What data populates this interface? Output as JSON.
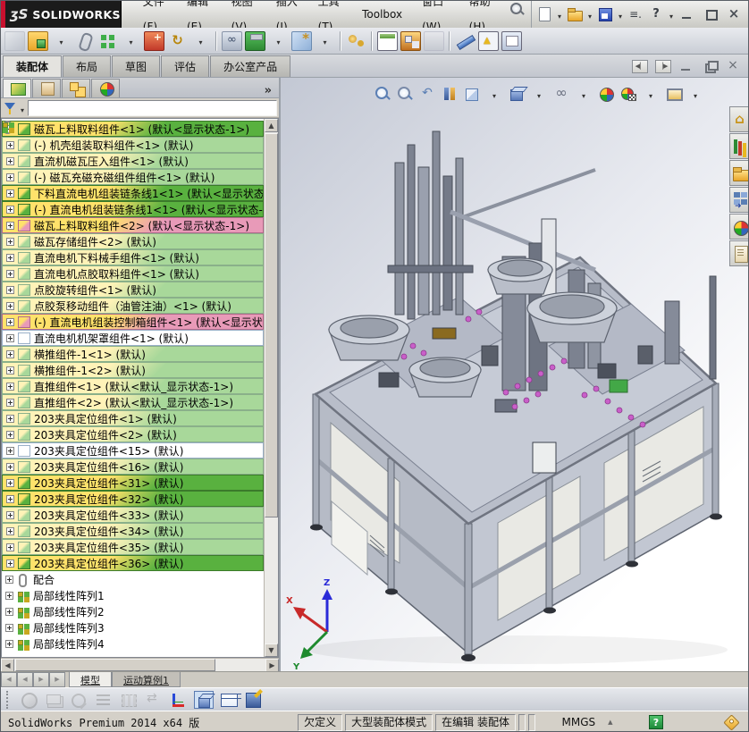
{
  "titlebar": {
    "logo_prefix": "ʒS",
    "logo_text": "SOLIDWORKS",
    "menus": [
      "文件(F)",
      "编辑(E)",
      "视图(V)",
      "插入(I)",
      "工具(T)",
      "Toolbox",
      "窗口(W)",
      "帮助(H)"
    ],
    "quick_access": [
      {
        "cls": "qa-new",
        "name": "new-document-icon"
      },
      {
        "cls": "drop",
        "name": "dropdown-arrow"
      },
      {
        "cls": "qa-open",
        "name": "open-document-icon"
      },
      {
        "cls": "drop",
        "name": "dropdown-arrow"
      },
      {
        "cls": "qa-save",
        "name": "save-document-icon"
      },
      {
        "cls": "drop",
        "name": "dropdown-arrow"
      },
      {
        "cls": "qa-props",
        "name": "properties-icon",
        "label": "≡."
      },
      {
        "cls": "qa-help",
        "name": "help-icon",
        "label": "?"
      },
      {
        "cls": "drop",
        "name": "dropdown-arrow"
      }
    ]
  },
  "main_toolbar": [
    {
      "cls": "ti-insert",
      "name": "insert-component-icon"
    },
    {
      "cls": "ti-open",
      "name": "open-part-icon"
    },
    {
      "cls": "drop",
      "name": "dropdown-arrow"
    },
    {
      "cls": "ti-mate",
      "name": "mate-icon"
    },
    {
      "cls": "ti-pattern",
      "name": "linear-component-pattern-icon"
    },
    {
      "cls": "drop",
      "name": "dropdown-arrow"
    },
    {
      "cls": "ti-fasteners",
      "name": "smart-fasteners-icon"
    },
    {
      "cls": "ti-move",
      "name": "move-component-icon"
    },
    {
      "cls": "drop",
      "name": "dropdown-arrow"
    },
    {
      "cls": "tsep",
      "name": "separator"
    },
    {
      "cls": "ti-hidden",
      "name": "show-hidden-components-icon"
    },
    {
      "cls": "ti-asmfeat",
      "name": "assembly-features-icon"
    },
    {
      "cls": "drop",
      "name": "dropdown-arrow"
    },
    {
      "cls": "ti-refgeo",
      "name": "reference-geometry-icon"
    },
    {
      "cls": "drop",
      "name": "dropdown-arrow"
    },
    {
      "cls": "tsep",
      "name": "separator"
    },
    {
      "cls": "ti-motion",
      "name": "new-motion-study-icon"
    },
    {
      "cls": "tsep",
      "name": "separator"
    },
    {
      "cls": "ti-bom",
      "name": "bill-of-materials-icon"
    },
    {
      "cls": "ti-explode",
      "name": "exploded-view-icon"
    },
    {
      "cls": "ti-explodeline",
      "name": "explode-line-sketch-icon"
    },
    {
      "cls": "tsep",
      "name": "separator"
    },
    {
      "cls": "ti-route",
      "name": "route-line-icon"
    },
    {
      "cls": "ti-interfere",
      "name": "interference-detection-icon"
    },
    {
      "cls": "ti-pic",
      "name": "snapshot-icon"
    }
  ],
  "command_tabs": [
    {
      "label": "装配体",
      "cls": "active"
    },
    {
      "label": "布局",
      "cls": ""
    },
    {
      "label": "草图",
      "cls": ""
    },
    {
      "label": "评估",
      "cls": ""
    },
    {
      "label": "办公室产品",
      "cls": ""
    }
  ],
  "feature_panel": {
    "fm_tabs": [
      {
        "cls": "fm-tree active",
        "name": "featuremanager-tree-tab"
      },
      {
        "cls": "fm-prop",
        "name": "propertymanager-tab"
      },
      {
        "cls": "fm-config",
        "name": "configurationmanager-tab"
      },
      {
        "cls": "fm-display",
        "name": "displaymanager-tab"
      }
    ],
    "overflow": "»",
    "tree": [
      {
        "cls": "ic-asm",
        "label": "磁瓦上料取料组件<1> (默认<显示状态-1>)"
      },
      {
        "cls": "ic-asm-light",
        "label": "(-) 机壳组装取料组件<1> (默认)"
      },
      {
        "cls": "ic-asm-light",
        "label": "直流机磁瓦压入组件<1> (默认)"
      },
      {
        "cls": "ic-asm-light",
        "label": "(-) 磁瓦充磁充磁组件组件<1> (默认)"
      },
      {
        "cls": "ic-asm",
        "label": "下料直流电机组装链条线1<1> (默认<显示状态-"
      },
      {
        "cls": "ic-asm",
        "label": "(-) 直流电机组装链条线1<1> (默认<显示状态-"
      },
      {
        "cls": "ic-asm-flex",
        "label": "磁瓦上料取料组件<2> (默认<显示状态-1>)"
      },
      {
        "cls": "ic-asm-light",
        "label": "磁瓦存储组件<2> (默认)"
      },
      {
        "cls": "ic-asm-light",
        "label": "直流电机下料械手组件<1> (默认)"
      },
      {
        "cls": "ic-asm-light",
        "label": "直流电机点胶取料组件<1> (默认)"
      },
      {
        "cls": "ic-asm-light",
        "label": "点胶旋转组件<1> (默认)"
      },
      {
        "cls": "ic-asm-light",
        "label": "点胶泵移动组件（油管注油）<1> (默认)"
      },
      {
        "cls": "ic-asm-flex",
        "label": "(-) 直流电机组装控制箱组件<1> (默认<显示状"
      },
      {
        "cls": "ic-asm-hidden",
        "label": "直流电机机架罩组件<1> (默认)"
      },
      {
        "cls": "ic-asm-light",
        "label": "横推组件-1<1> (默认)"
      },
      {
        "cls": "ic-asm-light",
        "label": "横推组件-1<2> (默认)"
      },
      {
        "cls": "ic-asm-light",
        "label": "直推组件<1> (默认<默认_显示状态-1>)"
      },
      {
        "cls": "ic-asm-light",
        "label": "直推组件<2> (默认<默认_显示状态-1>)"
      },
      {
        "cls": "ic-asm-light",
        "label": "203夹具定位组件<1> (默认)"
      },
      {
        "cls": "ic-asm-light",
        "label": "203夹具定位组件<2> (默认)"
      },
      {
        "cls": "ic-asm-hidden",
        "label": "203夹具定位组件<15> (默认)"
      },
      {
        "cls": "ic-asm-light",
        "label": "203夹具定位组件<16> (默认)"
      },
      {
        "cls": "ic-asm",
        "label": "203夹具定位组件<31> (默认)"
      },
      {
        "cls": "ic-asm",
        "label": "203夹具定位组件<32> (默认)"
      },
      {
        "cls": "ic-asm-light",
        "label": "203夹具定位组件<33> (默认)"
      },
      {
        "cls": "ic-asm-light",
        "label": "203夹具定位组件<34> (默认)"
      },
      {
        "cls": "ic-asm-light",
        "label": "203夹具定位组件<35> (默认)"
      },
      {
        "cls": "ic-asm",
        "label": "203夹具定位组件<36> (默认)"
      },
      {
        "cls": "ic-mates",
        "label": "配合"
      },
      {
        "cls": "ic-pattern",
        "label": "局部线性阵列1"
      },
      {
        "cls": "ic-pattern",
        "label": "局部线性阵列2"
      },
      {
        "cls": "ic-pattern",
        "label": "局部线性阵列3"
      },
      {
        "cls": "ic-pattern",
        "label": "局部线性阵列4"
      }
    ]
  },
  "viewport": {
    "hud": [
      {
        "cls": "hud-zoomfit",
        "name": "zoom-to-fit-icon"
      },
      {
        "cls": "hud-zoomarea",
        "name": "zoom-to-area-icon"
      },
      {
        "cls": "hud-prev",
        "name": "previous-view-icon"
      },
      {
        "cls": "hud-section",
        "name": "section-view-icon"
      },
      {
        "cls": "hud-orient",
        "name": "view-orientation-icon"
      },
      {
        "cls": "drop",
        "name": "dropdown-arrow"
      },
      {
        "cls": "hud-display",
        "name": "display-style-icon"
      },
      {
        "cls": "drop",
        "name": "dropdown-arrow"
      },
      {
        "cls": "hud-glasses",
        "name": "hide-show-items-icon"
      },
      {
        "cls": "drop",
        "name": "dropdown-arrow"
      },
      {
        "cls": "hud-appear",
        "name": "edit-appearance-icon"
      },
      {
        "cls": "hud-scene",
        "name": "apply-scene-icon"
      },
      {
        "cls": "drop",
        "name": "dropdown-arrow"
      },
      {
        "cls": "hud-monitor",
        "name": "view-settings-icon"
      },
      {
        "cls": "drop",
        "name": "dropdown-arrow"
      }
    ],
    "triad": {
      "x": "X",
      "y": "Y",
      "z": "Z"
    }
  },
  "task_pane": [
    {
      "cls": "tp-home",
      "name": "resources-home-icon"
    },
    {
      "cls": "tp-lib",
      "name": "design-library-icon"
    },
    {
      "cls": "tp-folder",
      "name": "file-explorer-icon"
    },
    {
      "cls": "tp-palette",
      "name": "view-palette-icon"
    },
    {
      "cls": "tp-appear",
      "name": "appearances-scenes-icon"
    },
    {
      "cls": "tp-props",
      "name": "custom-properties-icon"
    }
  ],
  "doc_tabs": {
    "nav": [
      "◀",
      "◀",
      "▶",
      "▶"
    ],
    "tabs": [
      {
        "label": "模型",
        "cls": "active"
      },
      {
        "label": "运动算例1",
        "cls": ""
      }
    ]
  },
  "bottom_toolbar": [
    {
      "cls": "bb-leaf gray",
      "name": "zebra-stripes-icon"
    },
    {
      "cls": "bb-sheets gray",
      "name": "display-states-icon"
    },
    {
      "cls": "bb-pencil gray",
      "name": "edit-sketch-icon"
    },
    {
      "cls": "bb-lines gray",
      "name": "annotations-icon"
    },
    {
      "cls": "bb-grid gray",
      "name": "grid-settings-icon"
    },
    {
      "cls": "bb-swap gray",
      "name": "compare-icon"
    },
    {
      "cls": "bb-axis",
      "name": "coordinate-system-icon"
    },
    {
      "cls": "bb-cube",
      "name": "shaded-cube-icon"
    },
    {
      "cls": "bb-table",
      "name": "design-table-icon"
    },
    {
      "cls": "bb-savebody",
      "name": "save-bodies-icon"
    }
  ],
  "status_bar": {
    "left": "SolidWorks Premium 2014 x64 版",
    "cells": [
      "欠定义",
      "大型装配体模式",
      "在编辑 装配体"
    ],
    "units": "MMGS",
    "help": "?"
  }
}
